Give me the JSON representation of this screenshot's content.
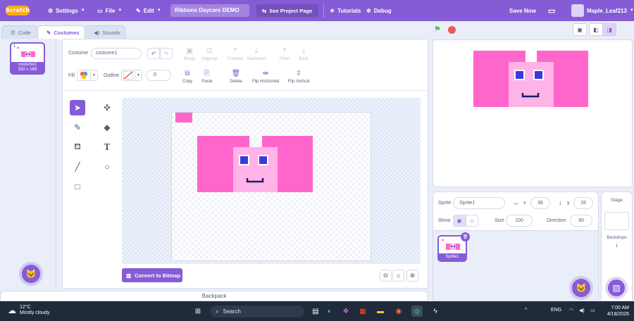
{
  "menubar": {
    "logo": "Scratch",
    "settings": "Settings",
    "file": "File",
    "edit": "Edit",
    "project_title": "Ribbons Daycare DEMO",
    "see_project": "See Project Page",
    "tutorials": "Tutorials",
    "debug": "Debug",
    "save_now": "Save Now",
    "username": "Maple_Leaf213"
  },
  "tabs": [
    {
      "label": "Code"
    },
    {
      "label": "Costumes"
    },
    {
      "label": "Sounds"
    }
  ],
  "costume_list": {
    "items": [
      {
        "index": "1",
        "name": "costume1",
        "size": "332 x 189"
      }
    ]
  },
  "paint_editor": {
    "costume_label": "Costume",
    "costume_name": "costume1",
    "fill_label": "Fill",
    "outline_label": "Outline",
    "outline_width": "0",
    "group": "Group",
    "ungroup": "Ungroup",
    "forward": "Forward",
    "backward": "Backward",
    "front": "Front",
    "back": "Back",
    "copy": "Copy",
    "paste": "Paste",
    "delete": "Delete",
    "flip_horizontal": "Flip Horizontal",
    "flip_vertical": "Flip Vertical",
    "convert_button": "Convert to Bitmap",
    "zoom_reset": "="
  },
  "backpack": {
    "label": "Backpack"
  },
  "sprite_info": {
    "sprite_label": "Sprite",
    "sprite_name": "Sprite1",
    "x_label": "x",
    "x_value": "36",
    "y_label": "y",
    "y_value": "28",
    "show_label": "Show",
    "size_label": "Size",
    "size_value": "100",
    "direction_label": "Direction",
    "direction_value": "90"
  },
  "sprites": [
    {
      "name": "Sprite1"
    }
  ],
  "stage_pane": {
    "title": "Stage",
    "backdrops_label": "Backdrops",
    "backdrops_count": "1"
  },
  "colors": {
    "accent": "#855cd6",
    "sprite_pink": "#ff66cc",
    "sprite_light_pink": "#ffb3e6",
    "eye_blue": "#3b3bdb",
    "mouth": "#1c1c6b"
  },
  "taskbar": {
    "temperature": "12°C",
    "weather": "Mostly cloudy",
    "search": "Search",
    "language": "ENG",
    "time": "7:00 AM",
    "date": "4/18/2026"
  }
}
